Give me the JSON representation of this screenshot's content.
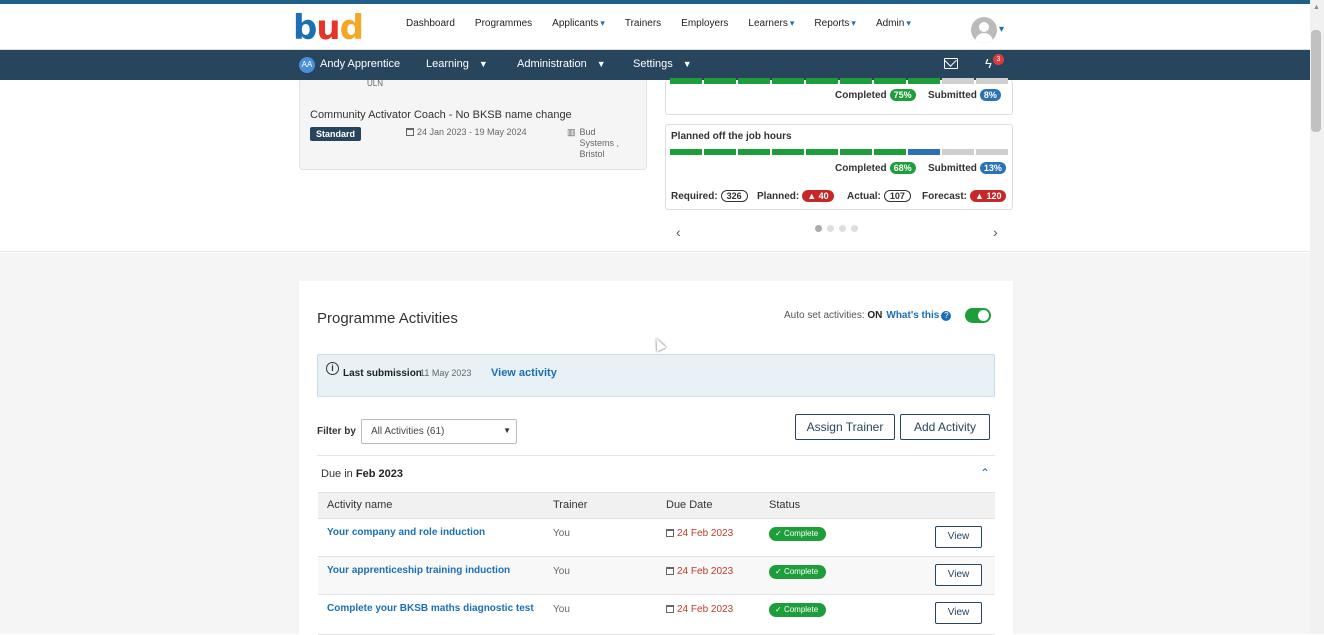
{
  "brand": {
    "logo_b": "b",
    "logo_u": "u",
    "logo_d": "d"
  },
  "main_nav": [
    {
      "label": "Dashboard",
      "dropdown": false
    },
    {
      "label": "Programmes",
      "dropdown": false
    },
    {
      "label": "Applicants",
      "dropdown": true
    },
    {
      "label": "Trainers",
      "dropdown": false
    },
    {
      "label": "Employers",
      "dropdown": false
    },
    {
      "label": "Learners",
      "dropdown": true
    },
    {
      "label": "Reports",
      "dropdown": true
    },
    {
      "label": "Admin",
      "dropdown": true
    }
  ],
  "sub_nav": {
    "initials": "AA",
    "user_name": "Andy Apprentice",
    "learning": "Learning",
    "administration": "Administration",
    "settings": "Settings",
    "notification_count": "3"
  },
  "learner_card": {
    "uln_label": "ULN",
    "programme": "Community Activator Coach - No BKSB name change",
    "badge": "Standard",
    "dates": "24 Jan 2023 - 19 May 2024",
    "employer_line1": "Bud",
    "employer_line2": "Systems ,",
    "employer_line3": "Bristol"
  },
  "top_progress": {
    "completed_label": "Completed",
    "completed_pct": "75%",
    "submitted_label": "Submitted",
    "submitted_pct": "8%",
    "completed_fraction": 0.75,
    "submitted_fraction": 0.08
  },
  "otj": {
    "title": "Planned off the job hours",
    "completed_label": "Completed",
    "completed_pct": "68%",
    "submitted_label": "Submitted",
    "submitted_pct": "13%",
    "completed_fraction": 0.68,
    "submitted_fraction": 0.13,
    "required_label": "Required:",
    "required": "326",
    "planned_label": "Planned:",
    "planned": "40",
    "actual_label": "Actual:",
    "actual": "107",
    "forecast_label": "Forecast:",
    "forecast": "120"
  },
  "carousel": {
    "pages": 4,
    "active": 0
  },
  "activities": {
    "title": "Programme Activities",
    "auto_label": "Auto set activities:",
    "auto_value": "ON",
    "whats_this": "What's this",
    "info_label": "Last submission",
    "info_date": "11 May 2023",
    "info_link": "View activity",
    "filter_label": "Filter by",
    "filter_value": "All Activities (61)",
    "assign_trainer": "Assign Trainer",
    "add_activity": "Add Activity",
    "due_prefix": "Due in",
    "due_month": "Feb 2023",
    "columns": {
      "name": "Activity name",
      "trainer": "Trainer",
      "due": "Due Date",
      "status": "Status"
    },
    "rows": [
      {
        "name": "Your company and role induction",
        "trainer": "You",
        "due": "24 Feb 2023",
        "status": "Complete",
        "action": "View"
      },
      {
        "name": "Your apprenticeship training induction",
        "trainer": "You",
        "due": "24 Feb 2023",
        "status": "Complete",
        "action": "View"
      },
      {
        "name": "Complete your BKSB maths diagnostic test",
        "trainer": "You",
        "due": "24 Feb 2023",
        "status": "Complete",
        "action": "View"
      }
    ]
  },
  "colors": {
    "navy": "#28455e",
    "link": "#1b6fb5",
    "green": "#1e9e3a",
    "red": "#c62828"
  }
}
